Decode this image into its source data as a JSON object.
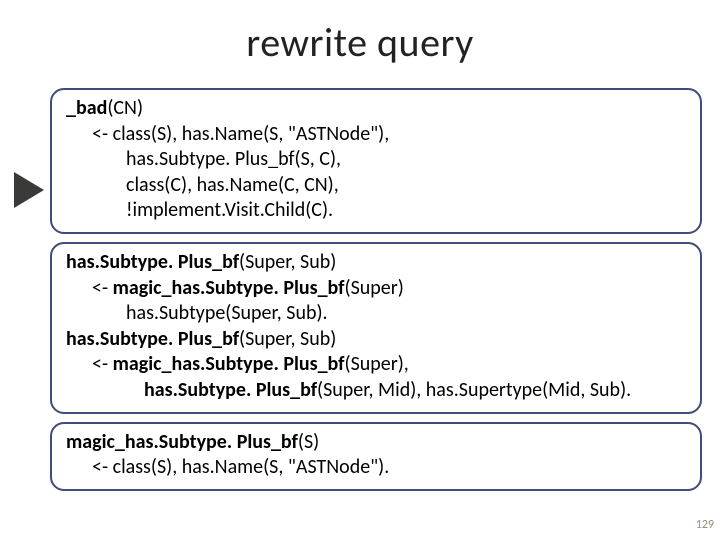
{
  "title": "rewrite query",
  "marker": {
    "name": "play-triangle-icon"
  },
  "box1": {
    "l1a": "_bad",
    "l1b": "(CN)",
    "l2": "<- class(S), has.Name(S, \"ASTNode\"),",
    "l3": "has.Subtype. Plus_bf(S, C),",
    "l4": "class(C), has.Name(C, CN),",
    "l5": "!implement.Visit.Child(C)."
  },
  "box2": {
    "l1a": "has.Subtype. Plus_bf",
    "l1b": "(Super, Sub)",
    "l2a": "<- ",
    "l2b": "magic_has.Subtype. Plus_bf",
    "l2c": "(Super)",
    "l3": "has.Subtype(Super, Sub).",
    "l4a": "has.Subtype. Plus_bf",
    "l4b": "(Super, Sub)",
    "l5a": "<- ",
    "l5b": "magic_has.Subtype. Plus_bf",
    "l5c": "(Super),",
    "l6a": "has.Subtype. Plus_bf",
    "l6b": "(Super, Mid), has.Supertype(Mid, Sub)."
  },
  "box3": {
    "l1a": "magic_has.Subtype. Plus_bf",
    "l1b": "(S)",
    "l2": "<- class(S), has.Name(S, \"ASTNode\")."
  },
  "pagenum": "129"
}
